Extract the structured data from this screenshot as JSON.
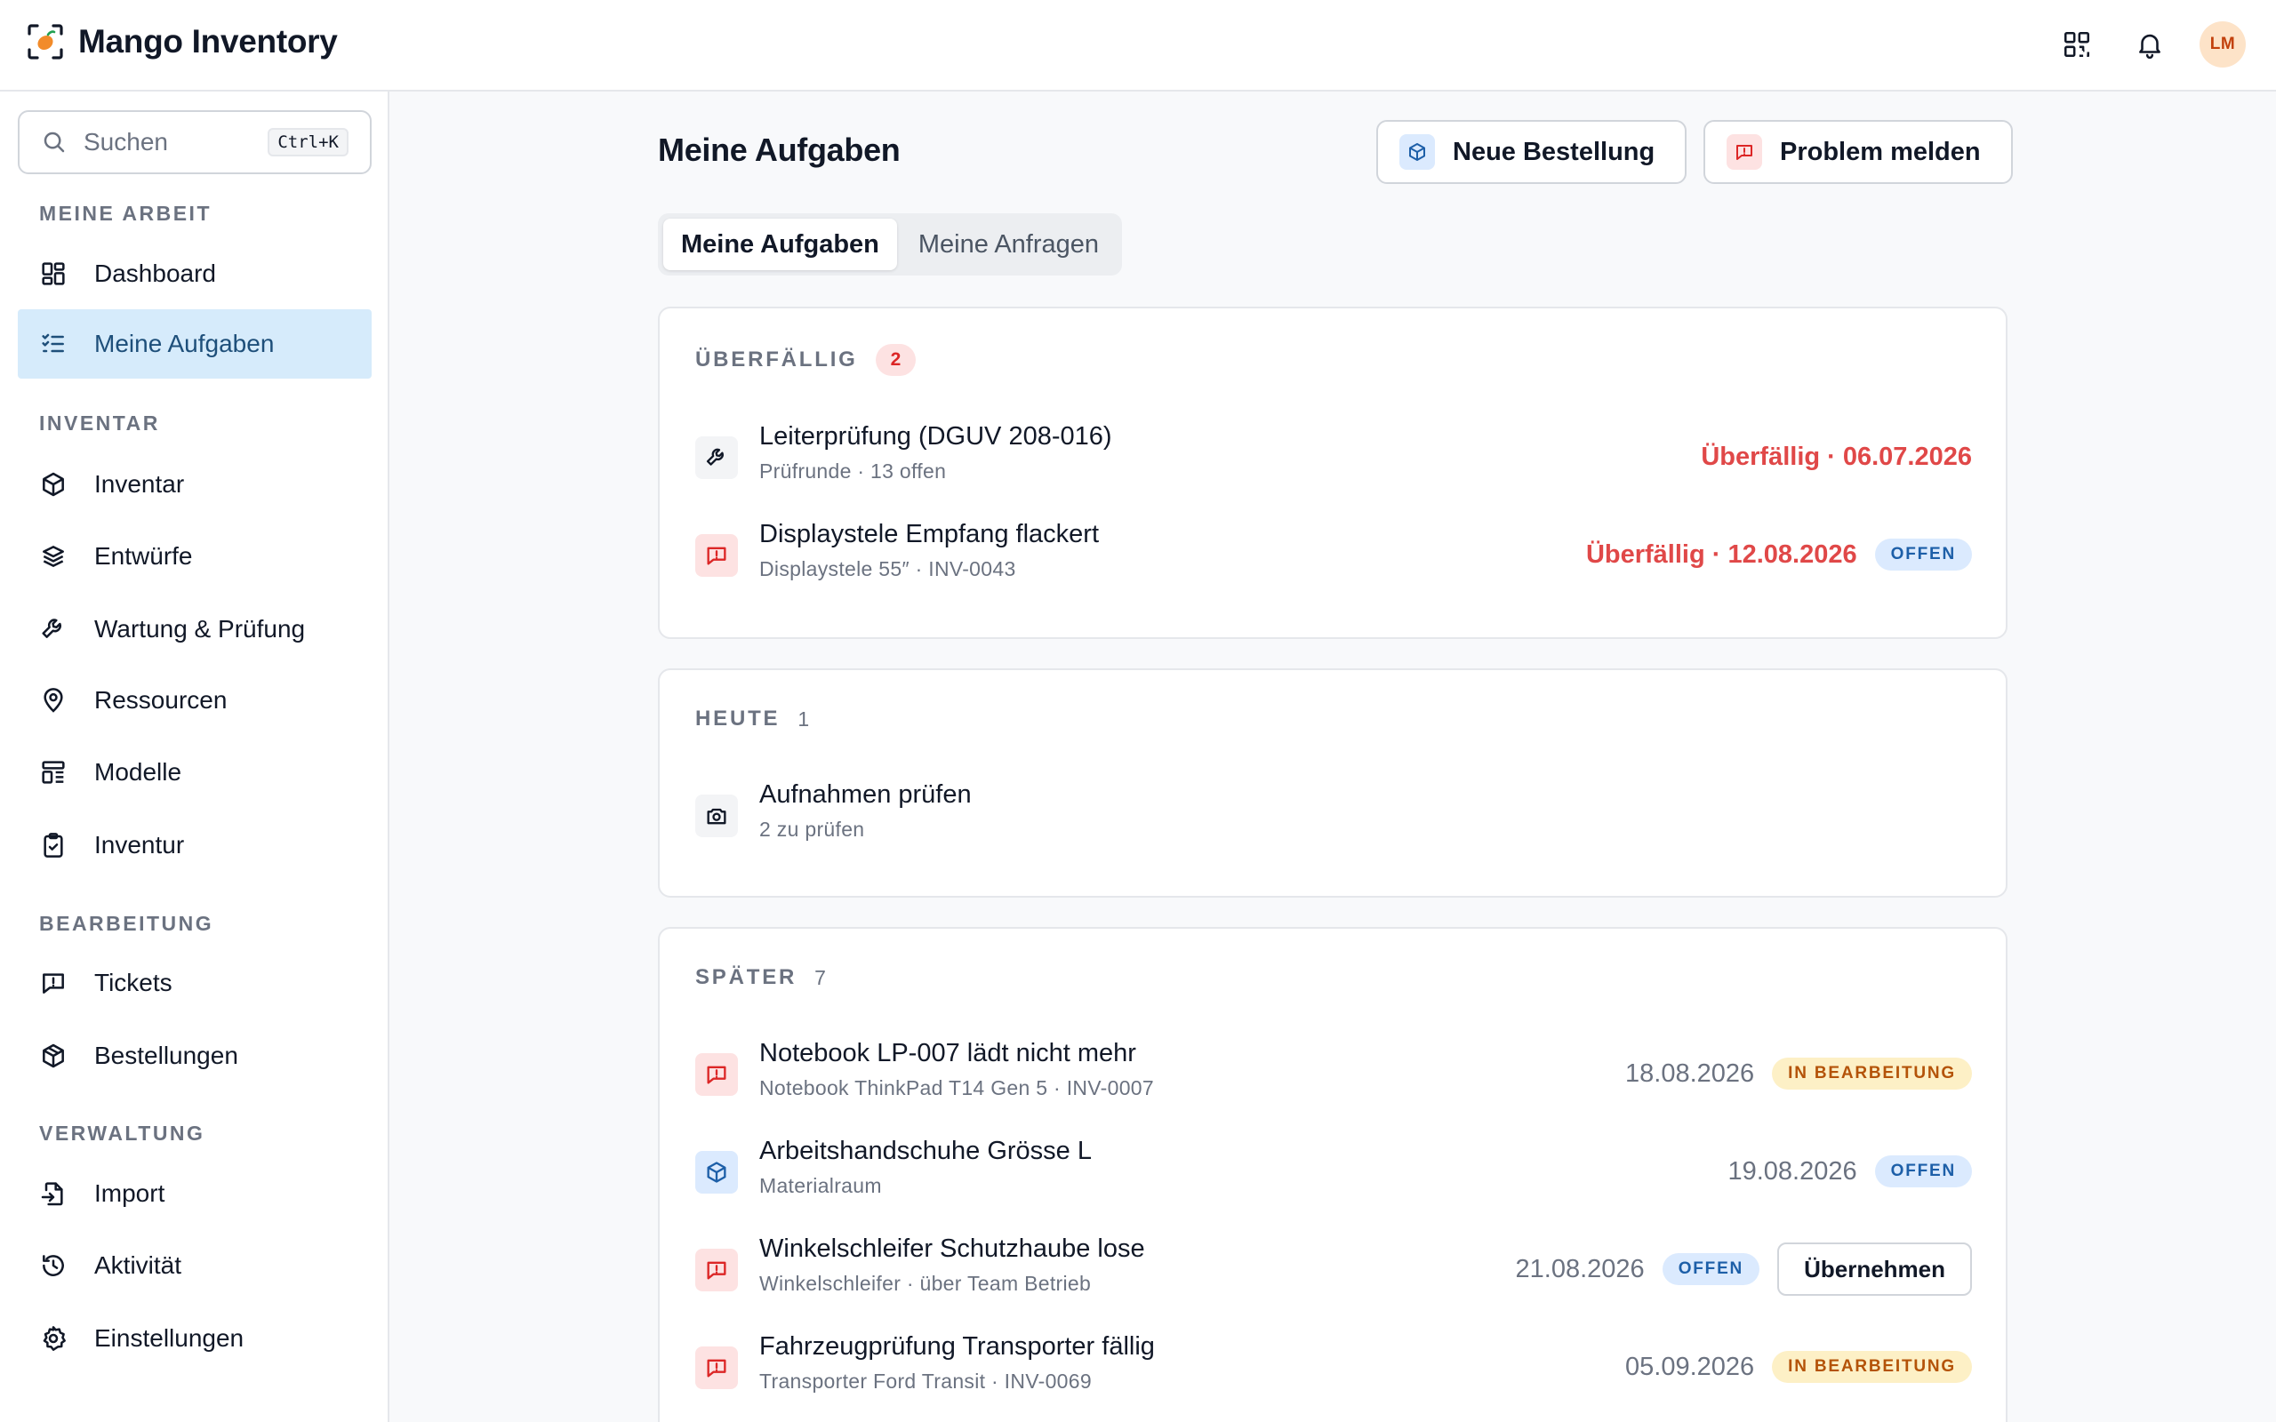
{
  "app": {
    "title": "Mango Inventory",
    "avatar_initials": "LM",
    "accent": "#f59e0b",
    "brand_color": "#f28b2a"
  },
  "topbar_icons": [
    "qr-code-icon",
    "bell-icon"
  ],
  "sidebar": {
    "search": {
      "placeholder": "Suchen",
      "shortcut": "Ctrl+K"
    },
    "sections": [
      {
        "label": "MEINE ARBEIT"
      },
      {
        "label": "INVENTAR"
      },
      {
        "label": "BEARBEITUNG"
      },
      {
        "label": "VERWALTUNG"
      }
    ],
    "items": [
      {
        "label": "Dashboard",
        "icon": "dashboard-icon"
      },
      {
        "label": "Meine Aufgaben",
        "icon": "tasks-icon",
        "active": true
      },
      {
        "label": "Inventar",
        "icon": "box-icon"
      },
      {
        "label": "Entwürfe",
        "icon": "layers-icon"
      },
      {
        "label": "Wartung & Prüfung",
        "icon": "wrench-icon"
      },
      {
        "label": "Ressourcen",
        "icon": "map-pin-icon"
      },
      {
        "label": "Modelle",
        "icon": "template-icon"
      },
      {
        "label": "Inventur",
        "icon": "clipboard-check-icon"
      },
      {
        "label": "Tickets",
        "icon": "message-alert-icon"
      },
      {
        "label": "Bestellungen",
        "icon": "package-icon"
      },
      {
        "label": "Import",
        "icon": "file-import-icon"
      },
      {
        "label": "Aktivität",
        "icon": "history-icon"
      },
      {
        "label": "Einstellungen",
        "icon": "settings-icon"
      }
    ]
  },
  "main": {
    "title": "Meine Aufgaben",
    "actions": {
      "new_order": "Neue Bestellung",
      "report_problem": "Problem melden"
    },
    "tabs": [
      {
        "label": "Meine Aufgaben",
        "active": true
      },
      {
        "label": "Meine Anfragen"
      }
    ],
    "groups": {
      "overdue": {
        "title": "ÜBERFÄLLIG",
        "count": "2",
        "items": [
          {
            "title": "Leiterprüfung (DGUV 208-016)",
            "subtitle": "Prüfrunde · 13 offen",
            "date": "Überfällig · 06.07.2026",
            "icon": "wrench-icon"
          },
          {
            "title": "Displaystele Empfang flackert",
            "subtitle": "Displaystele 55″ · INV-0043",
            "date": "Überfällig · 12.08.2026",
            "badge": "OFFEN",
            "icon": "message-alert-icon"
          }
        ]
      },
      "today": {
        "title": "HEUTE",
        "count": "1",
        "items": [
          {
            "title": "Aufnahmen prüfen",
            "subtitle": "2 zu prüfen",
            "icon": "camera-icon"
          }
        ]
      },
      "later": {
        "title": "SPÄTER",
        "count": "7",
        "items": [
          {
            "title": "Notebook LP-007 lädt nicht mehr",
            "subtitle": "Notebook ThinkPad T14 Gen 5 · INV-0007",
            "date": "18.08.2026",
            "badge": "IN BEARBEITUNG",
            "icon": "message-alert-icon"
          },
          {
            "title": "Arbeitshandschuhe Grösse L",
            "subtitle": "Materialraum",
            "date": "19.08.2026",
            "badge": "OFFEN",
            "icon": "package-icon"
          },
          {
            "title": "Winkelschleifer Schutzhaube lose",
            "subtitle": "Winkelschleifer · über Team Betrieb",
            "date": "21.08.2026",
            "badge": "OFFEN",
            "action": "Übernehmen",
            "icon": "message-alert-icon"
          },
          {
            "title": "Fahrzeugprüfung Transporter fällig",
            "subtitle": "Transporter Ford Transit · INV-0069",
            "date": "05.09.2026",
            "badge": "IN BEARBEITUNG",
            "icon": "message-alert-icon"
          }
        ]
      }
    }
  }
}
